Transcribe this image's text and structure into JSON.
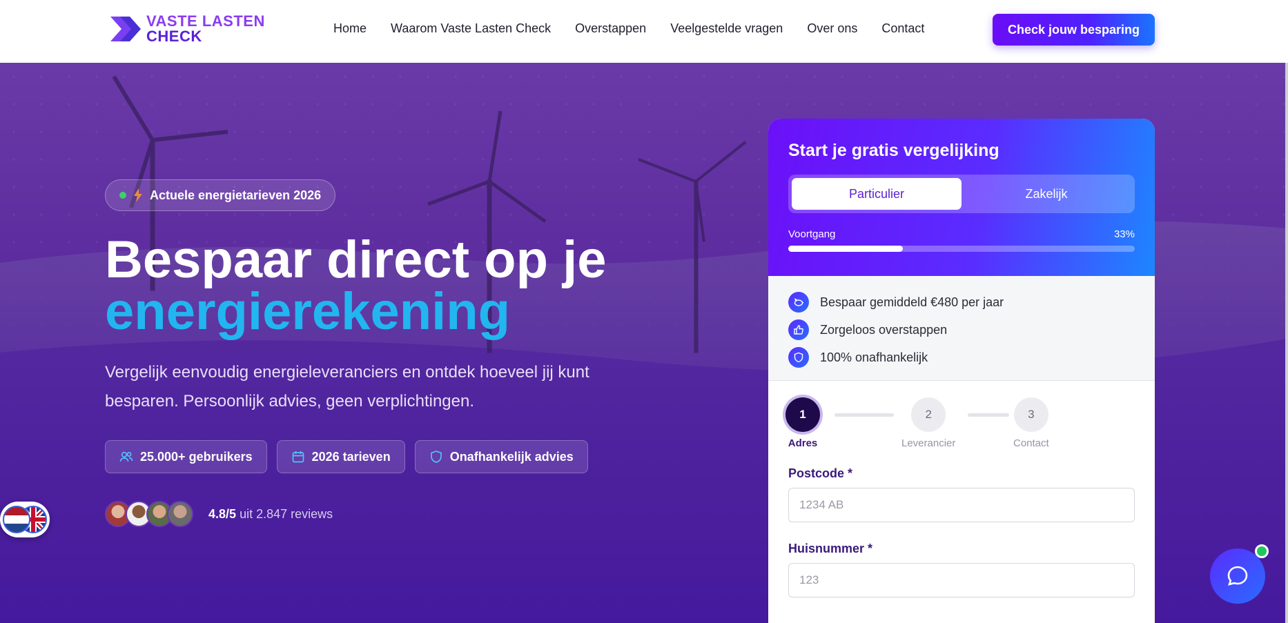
{
  "brand": {
    "line1": "VASTE LASTEN",
    "line2": "CHECK"
  },
  "nav": [
    "Home",
    "Waarom Vaste Lasten Check",
    "Overstappen",
    "Veelgestelde vragen",
    "Over ons",
    "Contact"
  ],
  "cta_label": "Check jouw besparing",
  "hero": {
    "badge": "Actuele energietarieven 2026",
    "title_line1": "Bespaar direct op je",
    "title_line2": "energierekening",
    "subtitle": "Vergelijk eenvoudig energieleveranciers en ontdek hoeveel jij kunt besparen. Persoonlijk advies, geen verplichtingen.",
    "chips": [
      "25.000+ gebruikers",
      "2026 tarieven",
      "Onafhankelijk advies"
    ],
    "rating": "4.8/5",
    "reviews_text": "uit 2.847 reviews"
  },
  "form": {
    "title": "Start je gratis vergelijking",
    "tabs": [
      "Particulier",
      "Zakelijk"
    ],
    "progress_label": "Voortgang",
    "progress_text": "33%",
    "progress_value": 0.33,
    "benefits": [
      "Bespaar gemiddeld €480 per jaar",
      "Zorgeloos overstappen",
      "100% onafhankelijk"
    ],
    "steps": [
      {
        "num": "1",
        "label": "Adres"
      },
      {
        "num": "2",
        "label": "Leverancier"
      },
      {
        "num": "3",
        "label": "Contact"
      }
    ],
    "postcode_label": "Postcode *",
    "postcode_placeholder": "1234 AB",
    "huisnummer_label": "Huisnummer *",
    "huisnummer_placeholder": "123"
  },
  "colors": {
    "accent": "#5b21d6",
    "cyan": "#22b6f0",
    "online": "#22c55e"
  },
  "icons": [
    "logo-arrow-icon",
    "bolt-icon",
    "users-icon",
    "calendar-icon",
    "shield-icon",
    "piggy-bank-icon",
    "thumbs-up-icon",
    "chat-icon",
    "language-flag-icon"
  ]
}
